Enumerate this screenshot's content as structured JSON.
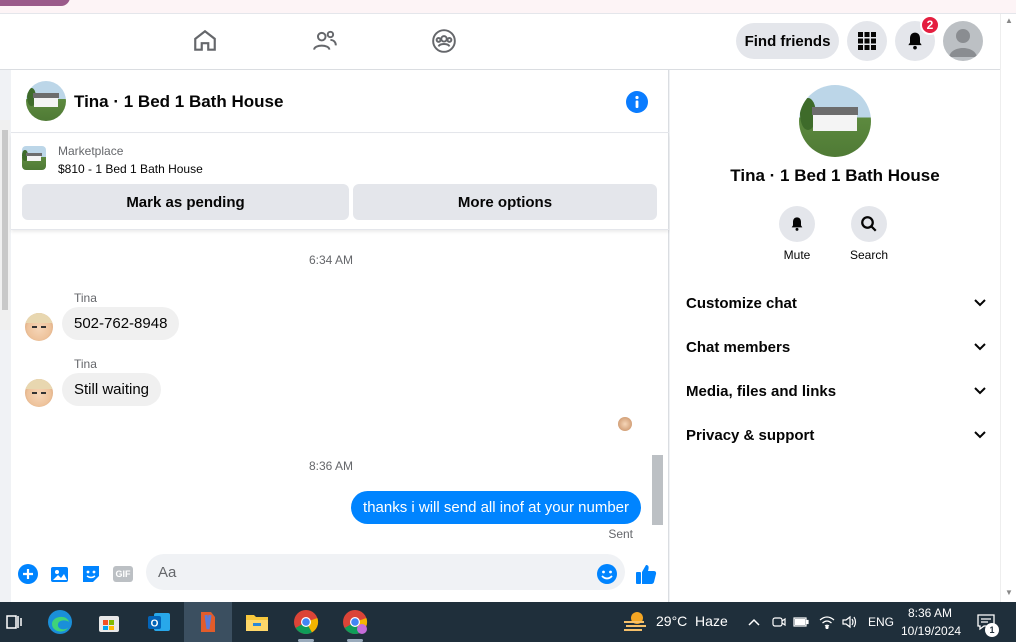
{
  "nav": {
    "find_friends": "Find friends",
    "notif_count": "2"
  },
  "chat": {
    "title": "Tina · 1 Bed 1 Bath House",
    "marketplace_label": "Marketplace",
    "listing": "$810 - 1 Bed 1 Bath House",
    "btn_pending": "Mark as pending",
    "btn_more": "More options"
  },
  "messages": {
    "time1": "6:34 AM",
    "sender1": "Tina",
    "msg1": "502-762-8948",
    "sender2": "Tina",
    "msg2": "Still waiting",
    "time2": "8:36 AM",
    "msg_out": "thanks i will send all inof at your number",
    "status": "Sent"
  },
  "composer": {
    "placeholder": "Aa",
    "gif_label": "GIF"
  },
  "details": {
    "title": "Tina · 1 Bed 1 Bath House",
    "mute": "Mute",
    "search": "Search",
    "sections": [
      "Customize chat",
      "Chat members",
      "Media, files and links",
      "Privacy & support"
    ]
  },
  "taskbar": {
    "weather": "29°C  Haze",
    "lang": "ENG",
    "time": "8:36 AM",
    "date": "10/19/2024",
    "notif_count": "1"
  },
  "colors": {
    "accent": "#0084ff",
    "badge": "#e41e3f",
    "taskbar": "#1f2f3b"
  }
}
